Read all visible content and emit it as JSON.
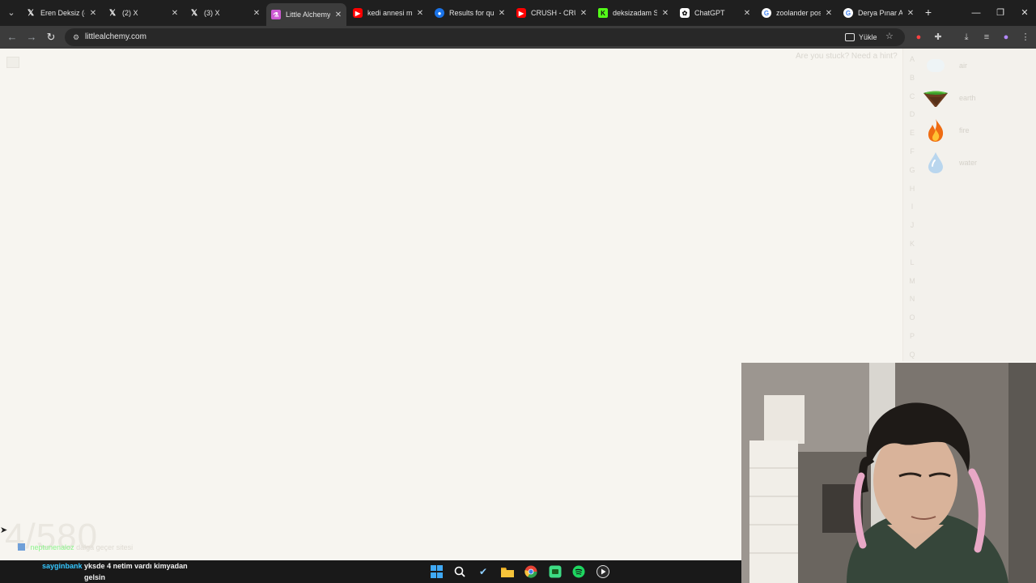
{
  "browser": {
    "tabs": [
      {
        "title": "Eren Deksiz (@",
        "favicon": "x-icon",
        "active": false
      },
      {
        "title": "(2) X",
        "favicon": "x-icon",
        "active": false
      },
      {
        "title": "(3) X",
        "favicon": "x-icon",
        "active": false
      },
      {
        "title": "Little Alchemy",
        "favicon": "little-alchemy-icon",
        "active": true
      },
      {
        "title": "kedi annesi mi",
        "favicon": "youtube-icon",
        "active": false
      },
      {
        "title": "Results for qui",
        "favicon": "search-results-icon",
        "active": false
      },
      {
        "title": "CRUSH - CRUS",
        "favicon": "youtube-icon",
        "active": false
      },
      {
        "title": "deksizadam St",
        "favicon": "kick-icon",
        "active": false
      },
      {
        "title": "ChatGPT",
        "favicon": "chatgpt-icon",
        "active": false
      },
      {
        "title": "zoolander pos",
        "favicon": "google-icon",
        "active": false
      },
      {
        "title": "Derya Pınar Ak",
        "favicon": "google-icon",
        "active": false
      }
    ],
    "url": "littlealchemy.com",
    "install_label": "Yükle"
  },
  "game": {
    "hint_text": "Are you stuck? Need a hint?",
    "letters": [
      "A",
      "B",
      "C",
      "D",
      "E",
      "F",
      "G",
      "H",
      "I",
      "J",
      "K",
      "L",
      "M",
      "N",
      "O",
      "P",
      "Q"
    ],
    "elements": [
      {
        "name": "air",
        "icon": "air-icon"
      },
      {
        "name": "earth",
        "icon": "earth-icon"
      },
      {
        "name": "fire",
        "icon": "fire-icon"
      },
      {
        "name": "water",
        "icon": "water-icon"
      }
    ],
    "counter": "4/580"
  },
  "chat": [
    {
      "user": "neptunenaloz",
      "message": "dalga geçer sitesi"
    },
    {
      "user": "sayginbank",
      "message": "yksde 4 netim vardı kimyadan gelsin"
    }
  ],
  "colors": {
    "tabstrip": "#1f1f1f",
    "toolbar": "#3c3c3c",
    "page_background": "#f7f5f0",
    "taskbar": "#191919"
  }
}
